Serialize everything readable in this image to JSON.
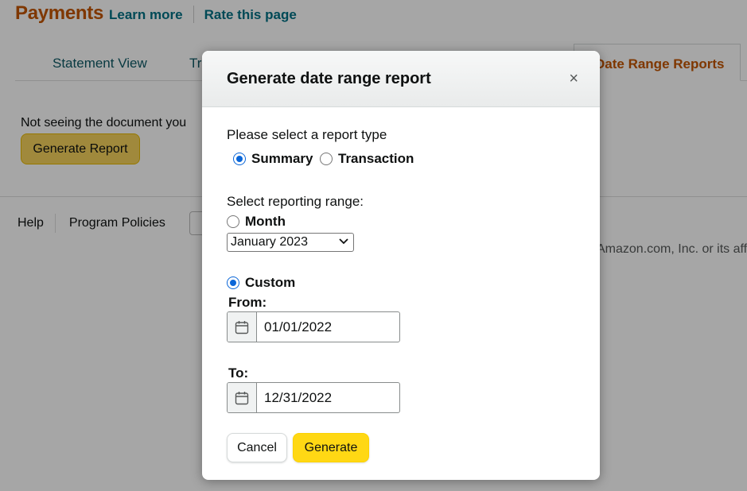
{
  "header": {
    "title": "Payments",
    "learn_more": "Learn more",
    "rate_page": "Rate this page"
  },
  "tabs": {
    "statement_view": "Statement View",
    "transaction_partial": "Tr",
    "date_range_reports": "Date Range Reports"
  },
  "main": {
    "notice_text": "Not seeing the document you",
    "notice_tail": ")",
    "generate_report_label": "Generate Report"
  },
  "footer": {
    "help": "Help",
    "program_policies": "Program Policies",
    "copyright_partial": "Amazon.com, Inc. or its affi"
  },
  "modal": {
    "title": "Generate date range report",
    "close_symbol": "×",
    "report_type_prompt": "Please select a report type",
    "report_types": {
      "summary": "Summary",
      "transaction": "Transaction",
      "selected": "Summary"
    },
    "range_prompt": "Select reporting range:",
    "month_label": "Month",
    "month_value": "January 2023",
    "custom_label": "Custom",
    "range_selected": "Custom",
    "from_label": "From:",
    "from_value": "01/01/2022",
    "to_label": "To:",
    "to_value": "12/31/2022",
    "cancel_label": "Cancel",
    "generate_label": "Generate"
  },
  "colors": {
    "brand_orange": "#c45500",
    "link_teal": "#007185",
    "primary_yellow": "#ffd814",
    "radio_blue": "#0a66d8"
  },
  "icons": {
    "close": "close-icon",
    "calendar": "calendar-icon",
    "dropdown": "chevron-down-icon"
  }
}
